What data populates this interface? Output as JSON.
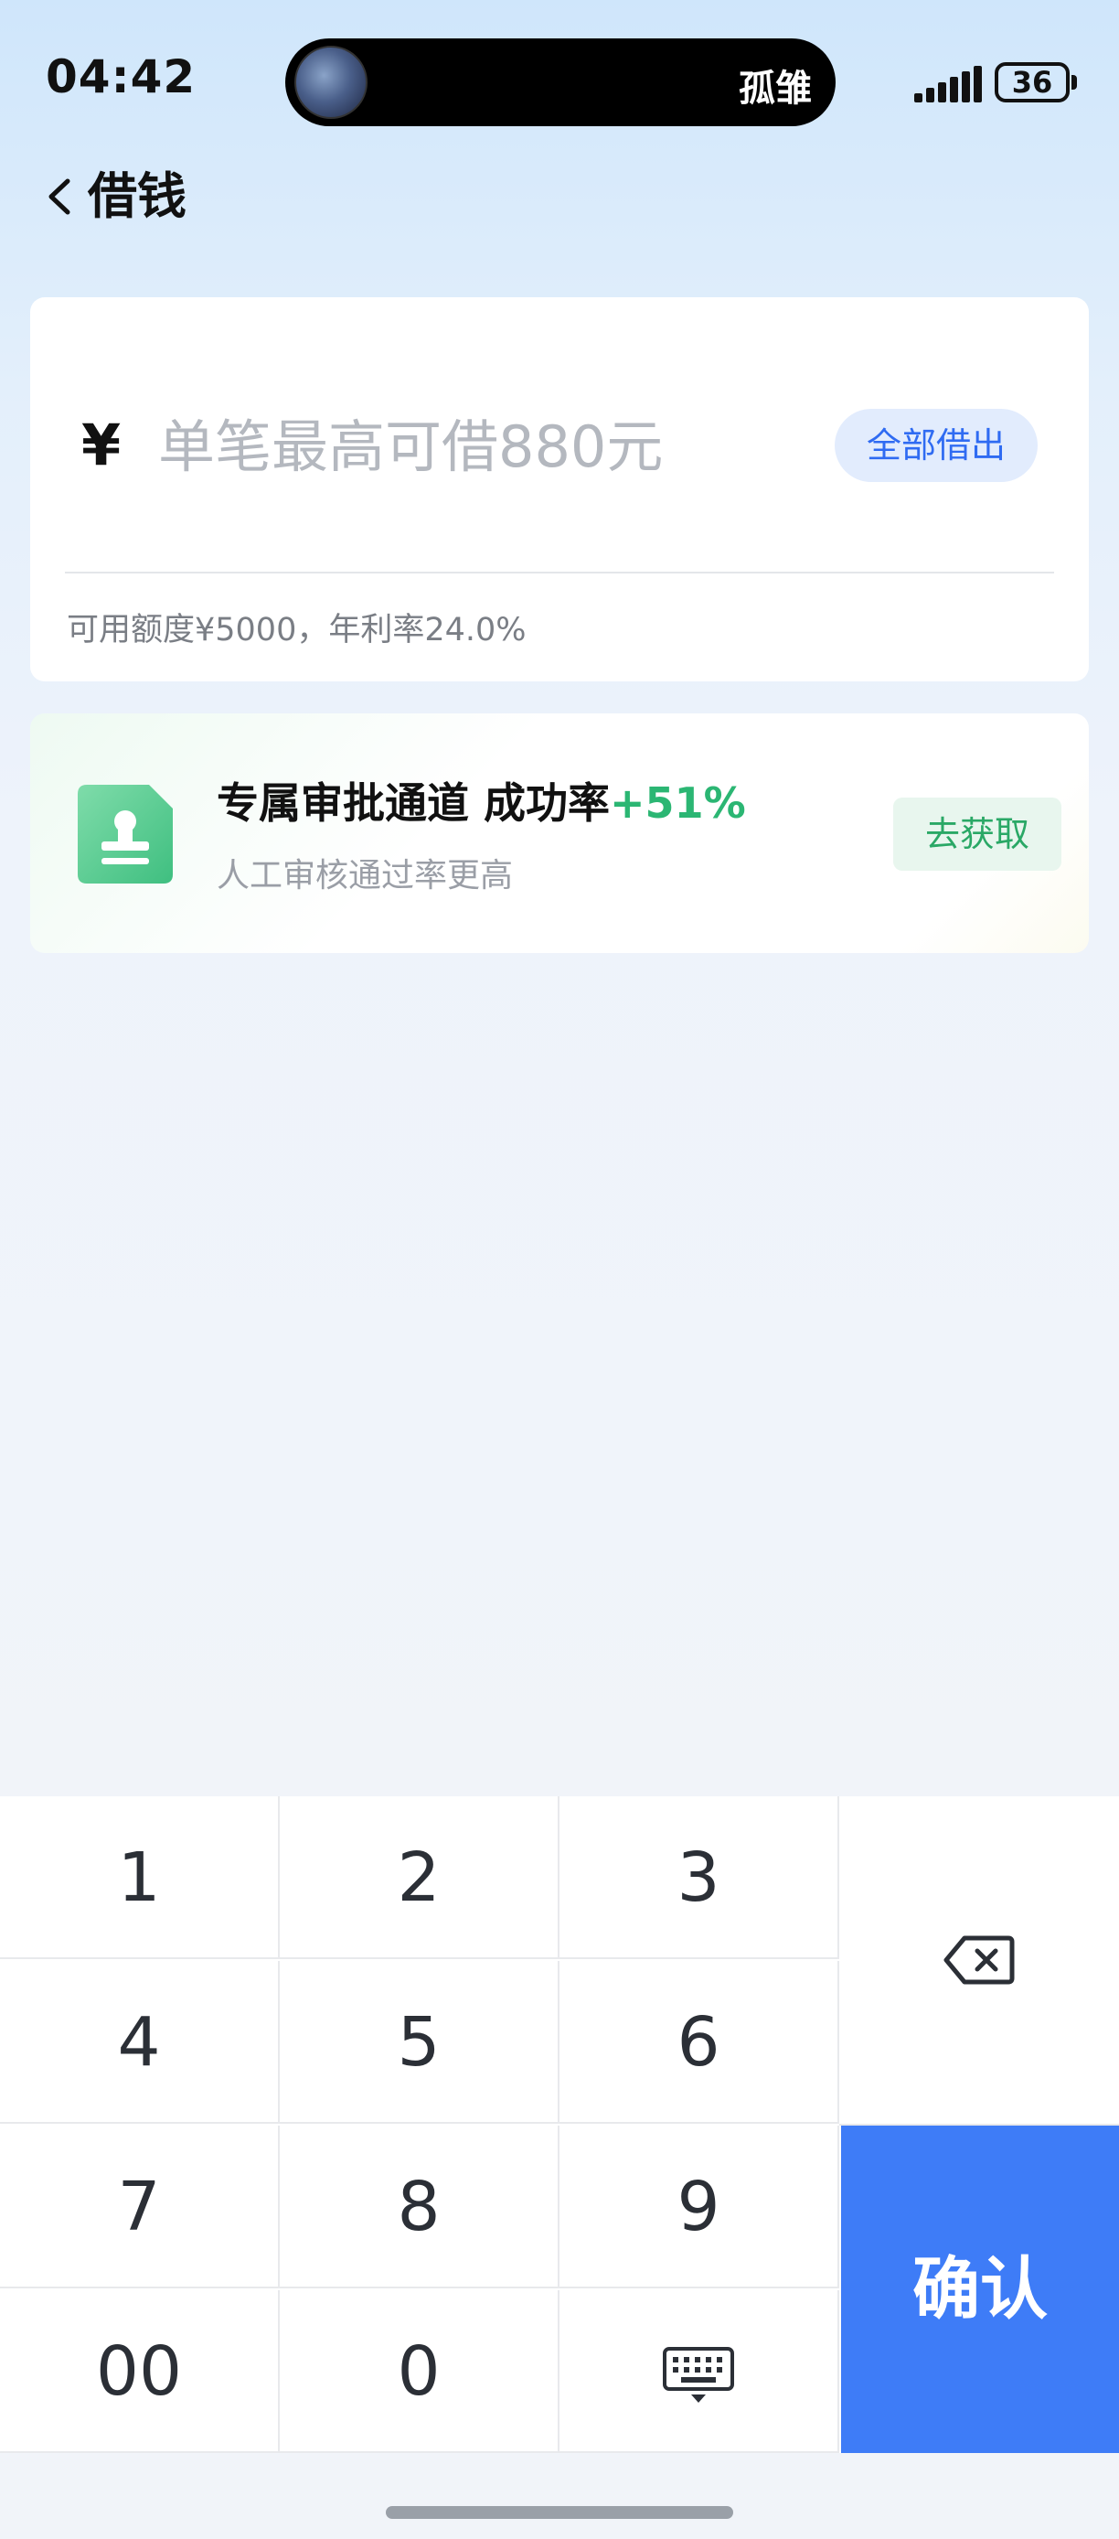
{
  "status_bar": {
    "time": "04:42",
    "island_text": "孤雏",
    "battery": "36"
  },
  "nav": {
    "title": "借钱"
  },
  "amount_card": {
    "currency_symbol": "¥",
    "input_placeholder": "单笔最高可借880元",
    "input_value": "",
    "borrow_all_label": "全部借出",
    "limit_info": "可用额度¥5000，年利率24.0%"
  },
  "approval_card": {
    "title": "专属审批通道 成功率",
    "rate": "+51%",
    "subtitle": "人工审核通过率更高",
    "button_label": "去获取"
  },
  "keypad": {
    "keys": [
      "1",
      "2",
      "3",
      "4",
      "5",
      "6",
      "7",
      "8",
      "9",
      "00",
      "0"
    ],
    "confirm_label": "确认"
  },
  "colors": {
    "accent_blue": "#3e7cf7",
    "success_green": "#2bb673"
  }
}
